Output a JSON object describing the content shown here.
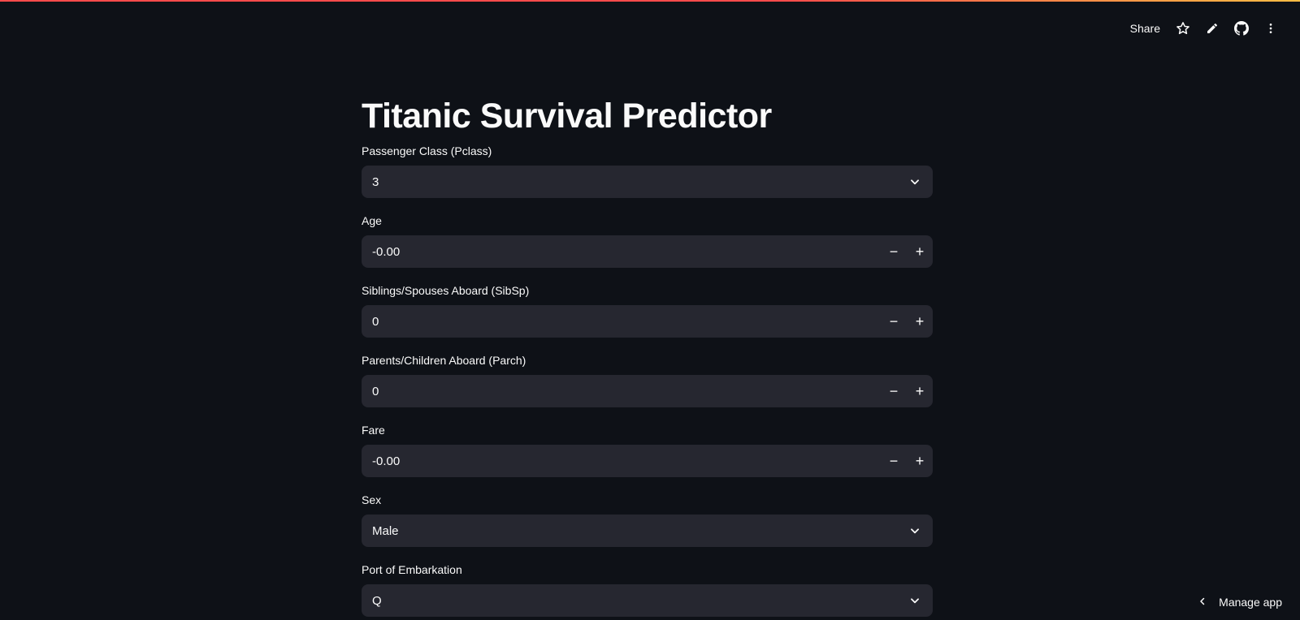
{
  "toolbar": {
    "share_label": "Share",
    "icons": [
      "star-icon",
      "pencil-icon",
      "github-icon",
      "more-vertical-icon"
    ]
  },
  "title": "Titanic Survival Predictor",
  "fields": {
    "pclass": {
      "label": "Passenger Class (Pclass)",
      "value": "3"
    },
    "age": {
      "label": "Age",
      "value": "-0.00"
    },
    "sibsp": {
      "label": "Siblings/Spouses Aboard (SibSp)",
      "value": "0"
    },
    "parch": {
      "label": "Parents/Children Aboard (Parch)",
      "value": "0"
    },
    "fare": {
      "label": "Fare",
      "value": "-0.00"
    },
    "sex": {
      "label": "Sex",
      "value": "Male"
    },
    "embarked": {
      "label": "Port of Embarkation",
      "value": "Q"
    }
  },
  "stepper": {
    "minus": "−",
    "plus": "+"
  },
  "footer": {
    "manage_app_label": "Manage app"
  },
  "colors": {
    "background": "#0e1117",
    "input_bg": "#262730",
    "text": "#fafafa",
    "accent": "#ff4b4b"
  }
}
